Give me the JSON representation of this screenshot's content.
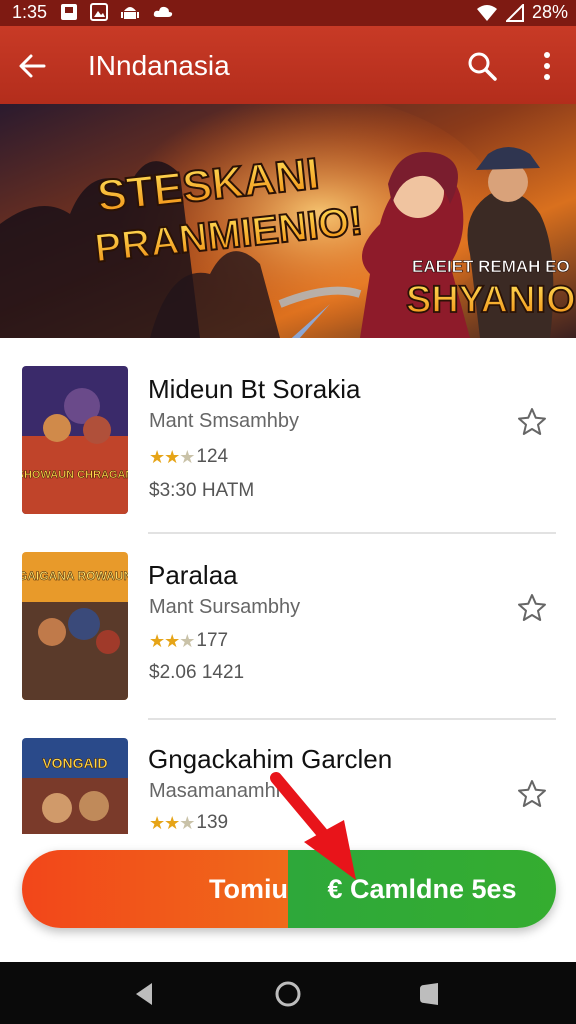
{
  "status_bar": {
    "time": "1:35",
    "battery": "28%"
  },
  "app_bar": {
    "title": "INndanasia"
  },
  "banner": {
    "headline_line1": "STESKANI",
    "headline_line2": "PRANMIENIO!",
    "tagline": "EAEIET REMAH EO",
    "sub_headline": "SHYANIO!"
  },
  "games": [
    {
      "title": "Mideun Bt Sorakia",
      "developer": "Mant Smsamhby",
      "rating_count": "124",
      "stars": 2.5,
      "meta": "$3:30 HATM",
      "thumb_text": "SHOWAUN CHRAGAN"
    },
    {
      "title": "Paralaa",
      "developer": "Mant Sursambhy",
      "rating_count": "177",
      "stars": 2.5,
      "meta": "$2.06 1421",
      "thumb_text": "GAIGANA ROWAUN"
    },
    {
      "title": "Gngackahim Garclen",
      "developer": "Masamanamhr",
      "rating_count": "139",
      "stars": 2.5,
      "meta": "",
      "thumb_text": "VONGAID"
    }
  ],
  "cta": {
    "left_label": "Tomiu",
    "right_label": "€ Camldne 5es"
  },
  "colors": {
    "app_bar": "#c33524",
    "cta_left": "#f2461a",
    "cta_right": "#34ab33",
    "star": "#e6a417"
  },
  "icons": [
    "back-arrow-icon",
    "search-icon",
    "more-vert-icon",
    "star-outline-icon",
    "nav-back-icon",
    "nav-home-icon",
    "nav-recents-icon"
  ]
}
